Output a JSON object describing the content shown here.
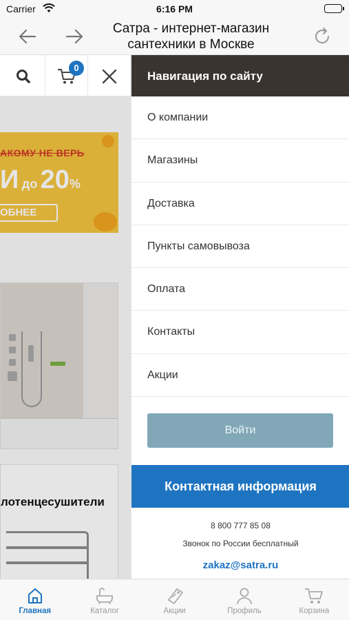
{
  "status_bar": {
    "carrier": "Carrier",
    "time": "6:16 PM"
  },
  "browser": {
    "title": "Сатра - интернет-магазин сантехники в Москве"
  },
  "page": {
    "cart_count": "0",
    "banner": {
      "strike_text": "АКОМУ НЕ ВЕРЬ",
      "sale_prefix": "И",
      "sale_small": "до",
      "sale_value": "20",
      "sale_unit": "%",
      "button_text": "ОБНЕЕ"
    },
    "category_label": "лотенцесушители"
  },
  "drawer": {
    "header": "Навигация по сайту",
    "items": [
      {
        "label": "О компании"
      },
      {
        "label": "Магазины"
      },
      {
        "label": "Доставка"
      },
      {
        "label": "Пункты самовывоза"
      },
      {
        "label": "Оплата"
      },
      {
        "label": "Контакты"
      },
      {
        "label": "Акции"
      }
    ],
    "login_button": "Войти",
    "contact": {
      "header": "Контактная информация",
      "phone": "8 800 777 85 08",
      "note": "Звонок по России бесплатный",
      "email": "zakaz@satra.ru"
    }
  },
  "tabs": [
    {
      "label": "Главная",
      "icon": "home-icon",
      "active": true
    },
    {
      "label": "Каталог",
      "icon": "bath-icon",
      "active": false
    },
    {
      "label": "Акции",
      "icon": "tag-icon",
      "active": false
    },
    {
      "label": "Профиль",
      "icon": "user-icon",
      "active": false
    },
    {
      "label": "Корзина",
      "icon": "cart-icon",
      "active": false
    }
  ],
  "colors": {
    "accent": "#1f74c1",
    "drawer_header": "#3a3431",
    "login_button": "#82a8b8",
    "banner": "#f4c440"
  }
}
